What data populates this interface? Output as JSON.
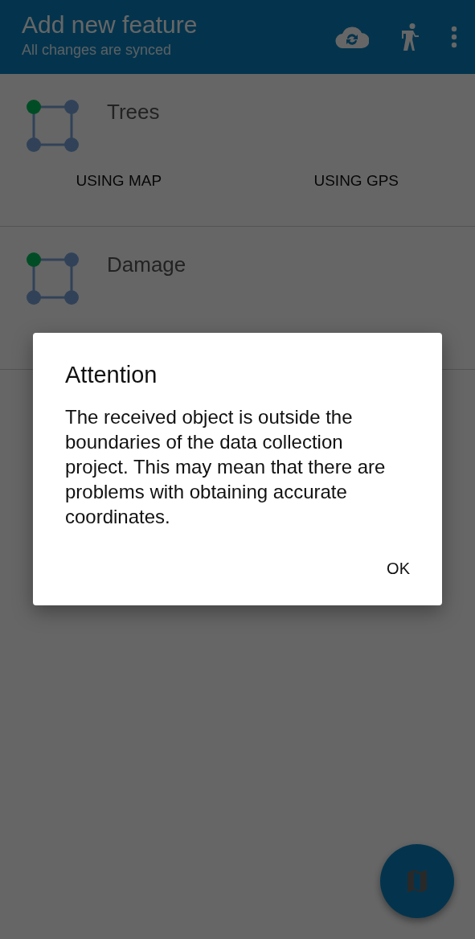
{
  "app_bar": {
    "title": "Add new feature",
    "subtitle": "All changes are synced"
  },
  "features": [
    {
      "name": "Trees",
      "buttons": [
        "USING MAP",
        "USING GPS"
      ]
    },
    {
      "name": "Damage"
    }
  ],
  "dialog": {
    "title": "Attention",
    "message": "The received object is outside the boundaries of the data collection project. This may mean that there are problems with obtaining accurate coordinates.",
    "buttons": [
      "OK"
    ]
  }
}
